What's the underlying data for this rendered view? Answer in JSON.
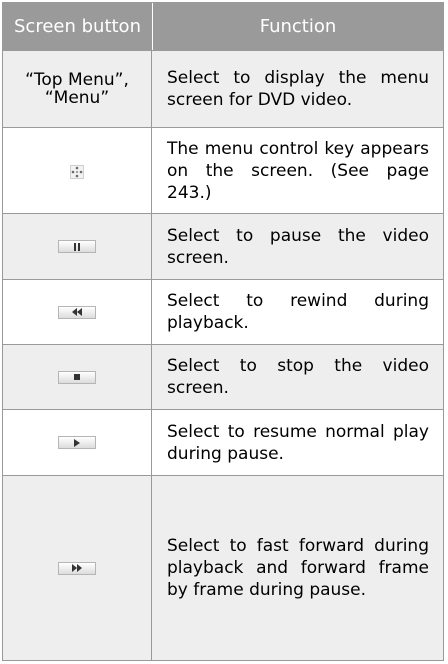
{
  "table": {
    "headers": {
      "button": "Screen button",
      "function": "Function"
    },
    "rows": [
      {
        "button_text_line1": "“Top Menu”,",
        "button_text_line2": "“Menu”",
        "function": "Select to display the menu screen for DVD video."
      },
      {
        "button_icon": "menu-control-key-icon",
        "function": "The menu control key ap­pears on the screen. (See page 243.)"
      },
      {
        "button_icon": "pause-icon",
        "function": "Select to pause the video screen."
      },
      {
        "button_icon": "rewind-icon",
        "function": "Select to rewind during playback."
      },
      {
        "button_icon": "stop-icon",
        "function": "Select to stop the video screen."
      },
      {
        "button_icon": "play-icon",
        "function": "Select to resume normal play during pause."
      },
      {
        "button_icon": "fast-forward-icon",
        "function": "Select to fast forward dur­ing playback and forward frame by frame during pause."
      }
    ]
  },
  "colors": {
    "header_bg": "#9a9a9a",
    "shade_row_bg": "#eeeeee",
    "border": "#999999"
  }
}
